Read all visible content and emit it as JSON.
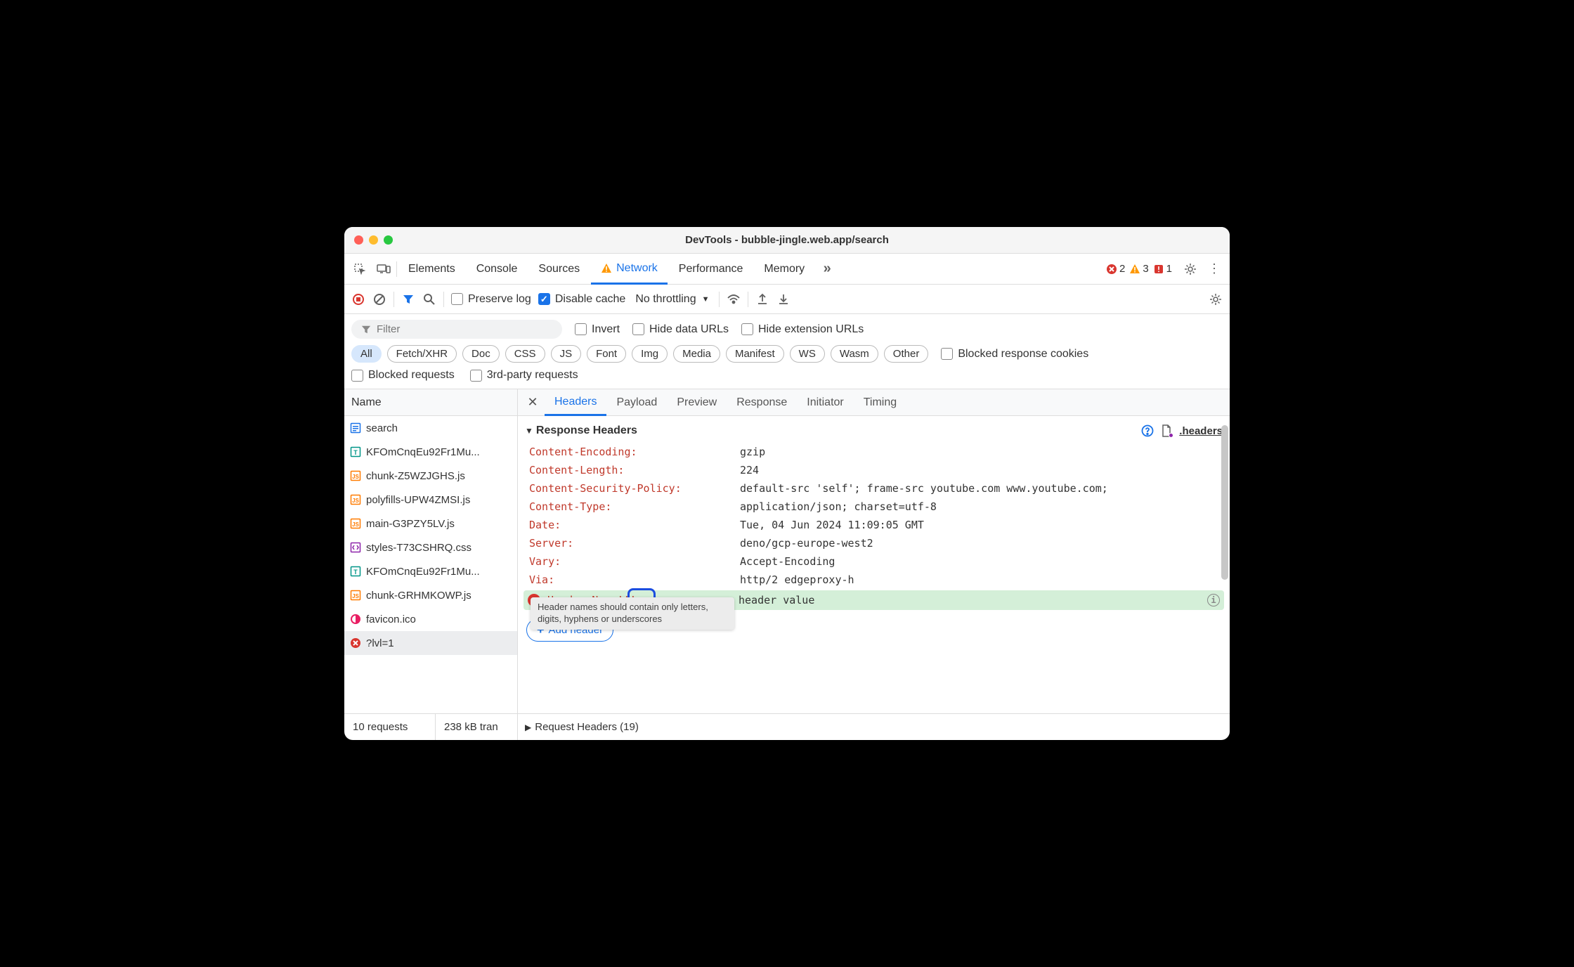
{
  "window": {
    "title": "DevTools - bubble-jingle.web.app/search"
  },
  "main_tabs": {
    "items": [
      "Elements",
      "Console",
      "Sources",
      "Network",
      "Performance",
      "Memory"
    ],
    "active": "Network",
    "badges": {
      "error_count": "2",
      "warning_count": "3",
      "issue_count": "1"
    }
  },
  "toolbar": {
    "preserve_log": "Preserve log",
    "disable_cache": "Disable cache",
    "throttling": "No throttling"
  },
  "filter_bar": {
    "filter_placeholder": "Filter",
    "invert": "Invert",
    "hide_data_urls": "Hide data URLs",
    "hide_ext_urls": "Hide extension URLs",
    "chips": [
      "All",
      "Fetch/XHR",
      "Doc",
      "CSS",
      "JS",
      "Font",
      "Img",
      "Media",
      "Manifest",
      "WS",
      "Wasm",
      "Other"
    ],
    "blocked_cookies": "Blocked response cookies",
    "blocked_requests": "Blocked requests",
    "third_party": "3rd-party requests"
  },
  "sidebar": {
    "header": "Name",
    "requests": [
      {
        "name": "search",
        "icon": "doc",
        "color": "#1a73e8"
      },
      {
        "name": "KFOmCnqEu92Fr1Mu...",
        "icon": "font",
        "color": "#009688"
      },
      {
        "name": "chunk-Z5WZJGHS.js",
        "icon": "script",
        "color": "#ff7b00"
      },
      {
        "name": "polyfills-UPW4ZMSI.js",
        "icon": "script",
        "color": "#ff7b00"
      },
      {
        "name": "main-G3PZY5LV.js",
        "icon": "script",
        "color": "#ff7b00"
      },
      {
        "name": "styles-T73CSHRQ.css",
        "icon": "css",
        "color": "#8e24aa"
      },
      {
        "name": "KFOmCnqEu92Fr1Mu...",
        "icon": "font",
        "color": "#009688"
      },
      {
        "name": "chunk-GRHMKOWP.js",
        "icon": "script",
        "color": "#ff7b00"
      },
      {
        "name": "favicon.ico",
        "icon": "img",
        "color": "#e91e63"
      },
      {
        "name": "?lvl=1",
        "icon": "error",
        "color": "#d9362f"
      }
    ],
    "selected_index": 9
  },
  "details": {
    "tabs": [
      "Headers",
      "Payload",
      "Preview",
      "Response",
      "Initiator",
      "Timing"
    ],
    "active": "Headers",
    "section_title": "Response Headers",
    "headers_link": ".headers",
    "response_headers": [
      {
        "name": "Content-Encoding:",
        "value": "gzip"
      },
      {
        "name": "Content-Length:",
        "value": "224"
      },
      {
        "name": "Content-Security-Policy:",
        "value": "default-src 'self'; frame-src youtube.com www.youtube.com;"
      },
      {
        "name": "Content-Type:",
        "value": "application/json; charset=utf-8"
      },
      {
        "name": "Date:",
        "value": "Tue, 04 Jun 2024 11:09:05 GMT"
      },
      {
        "name": "Server:",
        "value": "deno/gcp-europe-west2"
      },
      {
        "name": "Vary:",
        "value": "Accept-Encoding"
      },
      {
        "name": "Via:",
        "value": "http/2 edgeproxy-h"
      }
    ],
    "new_header": {
      "name": "Header-Name!!!",
      "value": "header value"
    },
    "tooltip": "Header names should contain only letters, digits, hyphens or underscores",
    "add_header_label": "Add header",
    "request_headers_section": "Request Headers (19)"
  },
  "footer": {
    "requests": "10 requests",
    "transferred": "238 kB tran"
  }
}
